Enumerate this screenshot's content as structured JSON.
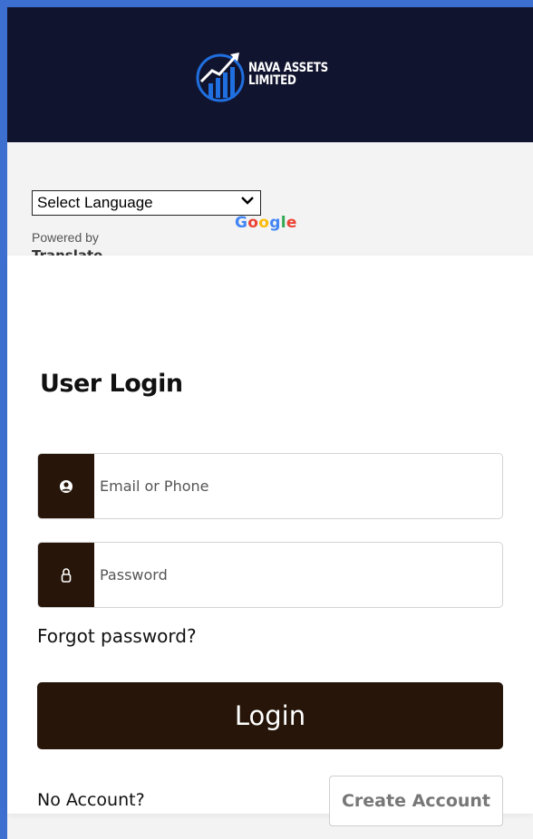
{
  "header": {
    "brand_line1": "NAVA ASSETS",
    "brand_line2": "LIMITED",
    "logo_icon": "growth-chart-logo-icon"
  },
  "translate": {
    "select_value": "Select Language",
    "powered_by": "Powered by",
    "google": [
      "G",
      "o",
      "o",
      "g",
      "l",
      "e"
    ],
    "translate_word": "Translate"
  },
  "login": {
    "title": "User Login",
    "email_placeholder": "Email or Phone",
    "email_icon": "user-circle-icon",
    "password_placeholder": "Password",
    "password_icon": "lock-icon",
    "forgot": "Forgot password?",
    "login_button": "Login",
    "no_account": "No Account?",
    "create_account": "Create Account"
  },
  "colors": {
    "frame": "#3d6fd1",
    "header_bg": "#11142e",
    "accent_dark": "#261508",
    "logo_blue": "#1f6fe0"
  }
}
